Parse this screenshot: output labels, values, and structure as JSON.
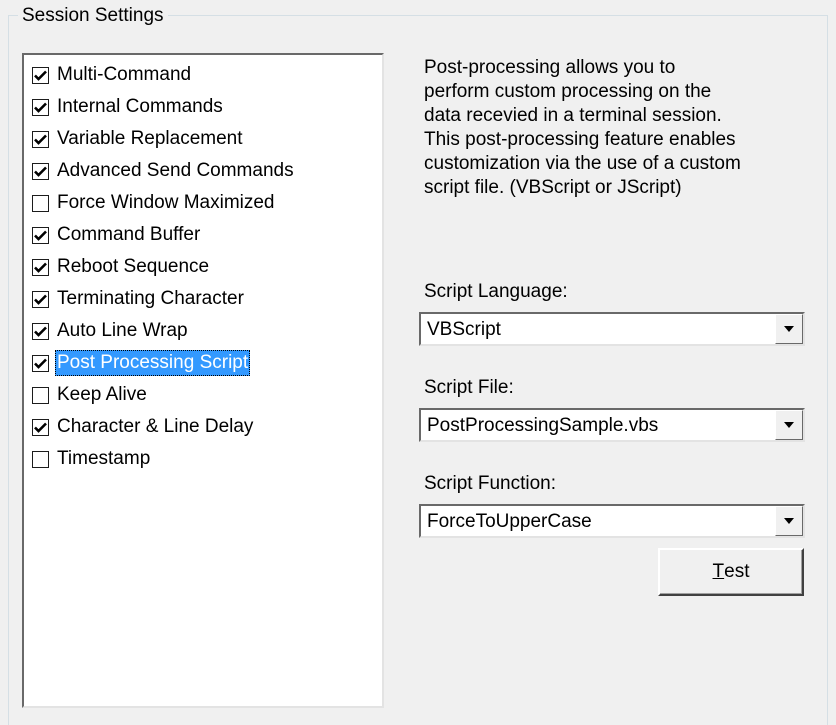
{
  "group": {
    "title": "Session Settings"
  },
  "options": [
    {
      "label": "Multi-Command",
      "checked": true
    },
    {
      "label": "Internal Commands",
      "checked": true
    },
    {
      "label": "Variable Replacement",
      "checked": true
    },
    {
      "label": "Advanced Send Commands",
      "checked": true
    },
    {
      "label": "Force Window Maximized",
      "checked": false
    },
    {
      "label": "Command Buffer",
      "checked": true
    },
    {
      "label": "Reboot Sequence",
      "checked": true
    },
    {
      "label": "Terminating Character",
      "checked": true
    },
    {
      "label": "Auto Line Wrap",
      "checked": true
    },
    {
      "label": "Post Processing Script",
      "checked": true,
      "selected": true
    },
    {
      "label": "Keep Alive",
      "checked": false
    },
    {
      "label": "Character & Line Delay",
      "checked": true
    },
    {
      "label": "Timestamp",
      "checked": false
    }
  ],
  "description": [
    "Post-processing allows you to",
    "perform custom processing on the",
    "data recevied in a terminal session.",
    "This post-processing feature enables",
    "customization via the use of a custom",
    "script file. (VBScript or JScript)"
  ],
  "script_language": {
    "label": "Script Language:",
    "value": "VBScript"
  },
  "script_file": {
    "label": "Script File:",
    "value": "PostProcessingSample.vbs"
  },
  "script_function": {
    "label": "Script Function:",
    "value": "ForceToUpperCase"
  },
  "test_button": {
    "mnemonic": "T",
    "rest": "est"
  },
  "colors": {
    "selection": "#3399ff",
    "background": "#f0f0f0"
  }
}
